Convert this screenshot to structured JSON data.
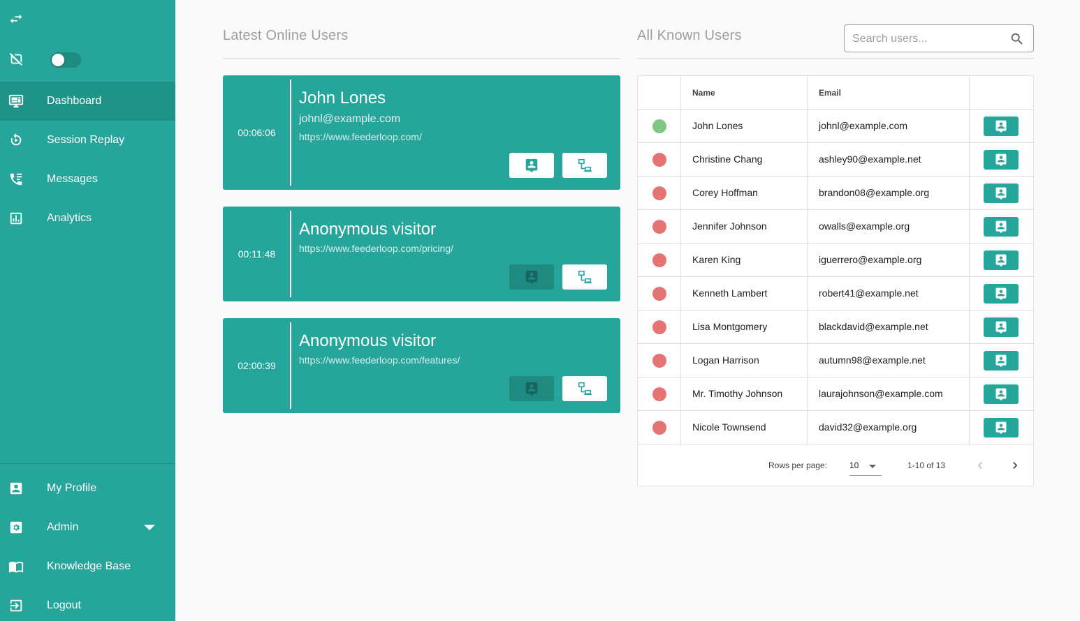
{
  "sidebar": {
    "top_icons": [
      {
        "icon": "swap-arrows-icon"
      },
      {
        "icon": "tracking-off-icon"
      }
    ],
    "toggle": {
      "state": "off"
    },
    "nav": [
      {
        "label": "Dashboard",
        "icon": "monitor-dashboard-icon",
        "active": true
      },
      {
        "label": "Session Replay",
        "icon": "replay-icon",
        "active": false
      },
      {
        "label": "Messages",
        "icon": "phone-messages-icon",
        "active": false
      },
      {
        "label": "Analytics",
        "icon": "analytics-chart-icon",
        "active": false
      }
    ],
    "bottom_nav": [
      {
        "label": "My Profile",
        "icon": "account-box-icon"
      },
      {
        "label": "Admin",
        "icon": "admin-settings-icon"
      },
      {
        "label": "Knowledge Base",
        "icon": "book-open-icon"
      },
      {
        "label": "Logout",
        "icon": "logout-icon"
      }
    ]
  },
  "online": {
    "title": "Latest Online Users",
    "cards": [
      {
        "time": "00:06:06",
        "name": "John Lones",
        "email": "johnl@example.com",
        "url": "https://www.feederloop.com/",
        "chat_enabled": true
      },
      {
        "time": "00:11:48",
        "name": "Anonymous visitor",
        "email": "",
        "url": "https://www.feederloop.com/pricing/",
        "chat_enabled": false
      },
      {
        "time": "02:00:39",
        "name": "Anonymous visitor",
        "email": "",
        "url": "https://www.feederloop.com/features/",
        "chat_enabled": false
      }
    ]
  },
  "known": {
    "title": "All Known Users",
    "search_placeholder": "Search users...",
    "columns": {
      "status": "",
      "name": "Name",
      "email": "Email",
      "action": ""
    },
    "rows": [
      {
        "status": "online",
        "name": "John Lones",
        "email": "johnl@example.com"
      },
      {
        "status": "offline",
        "name": "Christine Chang",
        "email": "ashley90@example.net"
      },
      {
        "status": "offline",
        "name": "Corey Hoffman",
        "email": "brandon08@example.org"
      },
      {
        "status": "offline",
        "name": "Jennifer Johnson",
        "email": "owalls@example.org"
      },
      {
        "status": "offline",
        "name": "Karen King",
        "email": "iguerrero@example.org"
      },
      {
        "status": "offline",
        "name": "Kenneth Lambert",
        "email": "robert41@example.net"
      },
      {
        "status": "offline",
        "name": "Lisa Montgomery",
        "email": "blackdavid@example.net"
      },
      {
        "status": "offline",
        "name": "Logan Harrison",
        "email": "autumn98@example.net"
      },
      {
        "status": "offline",
        "name": "Mr. Timothy Johnson",
        "email": "laurajohnson@example.com"
      },
      {
        "status": "offline",
        "name": "Nicole Townsend",
        "email": "david32@example.org"
      }
    ],
    "pagination": {
      "rows_per_page_label": "Rows per page:",
      "rows_per_page": "10",
      "range": "1-10 of 13"
    }
  },
  "colors": {
    "brand": "#26a69a",
    "brand_dark": "#1f8a80",
    "online": "#81c784",
    "offline": "#e57373"
  }
}
